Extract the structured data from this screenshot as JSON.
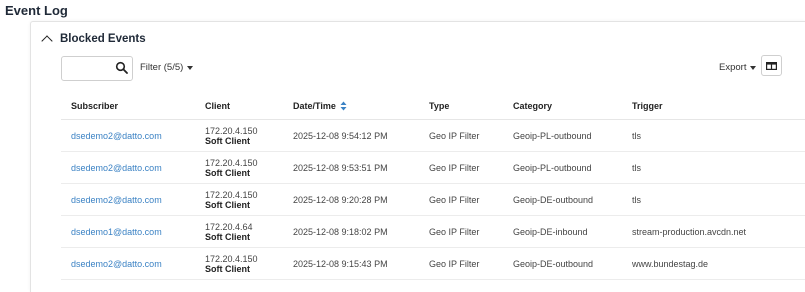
{
  "page": {
    "title": "Event Log"
  },
  "section": {
    "title": "Blocked Events"
  },
  "toolbar": {
    "search_value": "",
    "filter_label": "Filter (5/5)",
    "export_label": "Export"
  },
  "table": {
    "columns": [
      "Subscriber",
      "Client",
      "Date/Time",
      "Type",
      "Category",
      "Trigger"
    ],
    "rows": [
      {
        "subscriber": "dsedemo2@datto.com",
        "client_ip": "172.20.4.150",
        "client_type": "Soft Client",
        "datetime": "2025-12-08 9:54:12 PM",
        "type": "Geo IP Filter",
        "category": "Geoip-PL-outbound",
        "trigger": "tls"
      },
      {
        "subscriber": "dsedemo2@datto.com",
        "client_ip": "172.20.4.150",
        "client_type": "Soft Client",
        "datetime": "2025-12-08 9:53:51 PM",
        "type": "Geo IP Filter",
        "category": "Geoip-PL-outbound",
        "trigger": "tls"
      },
      {
        "subscriber": "dsedemo2@datto.com",
        "client_ip": "172.20.4.150",
        "client_type": "Soft Client",
        "datetime": "2025-12-08 9:20:28 PM",
        "type": "Geo IP Filter",
        "category": "Geoip-DE-outbound",
        "trigger": "tls"
      },
      {
        "subscriber": "dsedemo1@datto.com",
        "client_ip": "172.20.4.64",
        "client_type": "Soft Client",
        "datetime": "2025-12-08 9:18:02 PM",
        "type": "Geo IP Filter",
        "category": "Geoip-DE-inbound",
        "trigger": "stream-production.avcdn.net"
      },
      {
        "subscriber": "dsedemo2@datto.com",
        "client_ip": "172.20.4.150",
        "client_type": "Soft Client",
        "datetime": "2025-12-08 9:15:43 PM",
        "type": "Geo IP Filter",
        "category": "Geoip-DE-outbound",
        "trigger": "www.bundestag.de"
      }
    ]
  },
  "icons": {
    "collapse": "chevron-up-icon",
    "search": "search-icon",
    "filter_caret": "caret-down-icon",
    "export_caret": "caret-down-icon",
    "columns": "columns-icon",
    "sort": "sort-icon"
  },
  "colors": {
    "link": "#3b82c4",
    "border": "#cfcfcf",
    "text": "#222222"
  }
}
